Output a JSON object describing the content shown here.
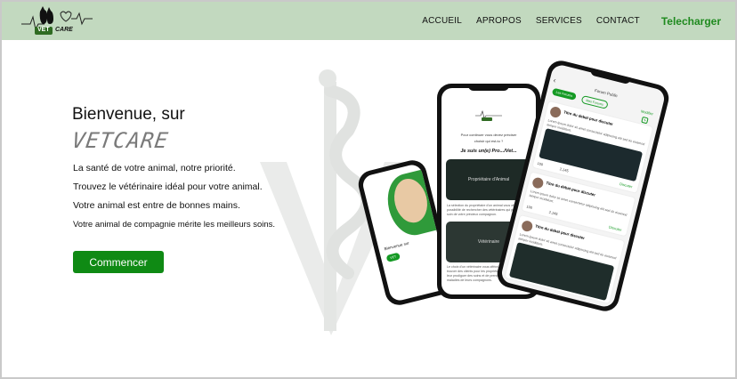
{
  "navbar": {
    "logo_text_vet": "VET",
    "logo_text_care": "CARE",
    "links": [
      "ACCUEIL",
      "APROPOS",
      "SERVICES",
      "CONTACT"
    ],
    "cta_label": "Telecharger"
  },
  "hero": {
    "title": "Bienvenue, sur",
    "brand": "VETCARE",
    "lines": [
      "La santé de votre animal, notre priorité.",
      "Trouvez le vétérinaire idéal pour votre animal.",
      "Votre animal est entre de bonnes mains.",
      "Votre animal de compagnie mérite les meilleurs soins."
    ],
    "button_label": "Commencer"
  },
  "phone_center": {
    "intro": "Pour continuer vous devez préciser",
    "intro2": "choisir qui est-tu ?",
    "heading": "Je suis un(e) Pro.../Vet...",
    "card1_label": "Propriétaire d'Animal",
    "card1_text": "La sélection du propriétaire d'un animal vous offrira la possibilité de rechercher des vétérinaires qui prendront soin de votre précieux compagnon.",
    "card2_label": "Vétérinaire",
    "card2_text": "Le choix d'un vétérinaire vous offrira la possibilité de trouver des clients pour les propriétaires d'animaux afin de leur prodiguer des soins et de prendre en charge les maladies de leurs compagnons."
  },
  "phone_right": {
    "title": "Forum Public",
    "tab_active": "Les Forums",
    "tab_inactive": "Mes Forums",
    "modify": "Modifier",
    "posts": [
      {
        "title": "Titre du debat pour discuter",
        "likes": "100",
        "comments": "2,145",
        "action": "Discuter"
      },
      {
        "title": "Titre du debat pour discuter",
        "likes": "100",
        "comments": "2,145",
        "action": "Discuter"
      },
      {
        "title": "Titre du debat pour discuter",
        "likes": "",
        "comments": "",
        "action": ""
      }
    ],
    "post_text": "Lorem ipsum dolor sit amet consectetur adipiscing elit sed do eiusmod tempor incididunt."
  },
  "phone_left": {
    "label": "Bienvenue sur",
    "badge": "VET"
  },
  "colors": {
    "navbar": "#c2d9bf",
    "accent": "#1f8a1f",
    "button": "#0f8a14"
  }
}
